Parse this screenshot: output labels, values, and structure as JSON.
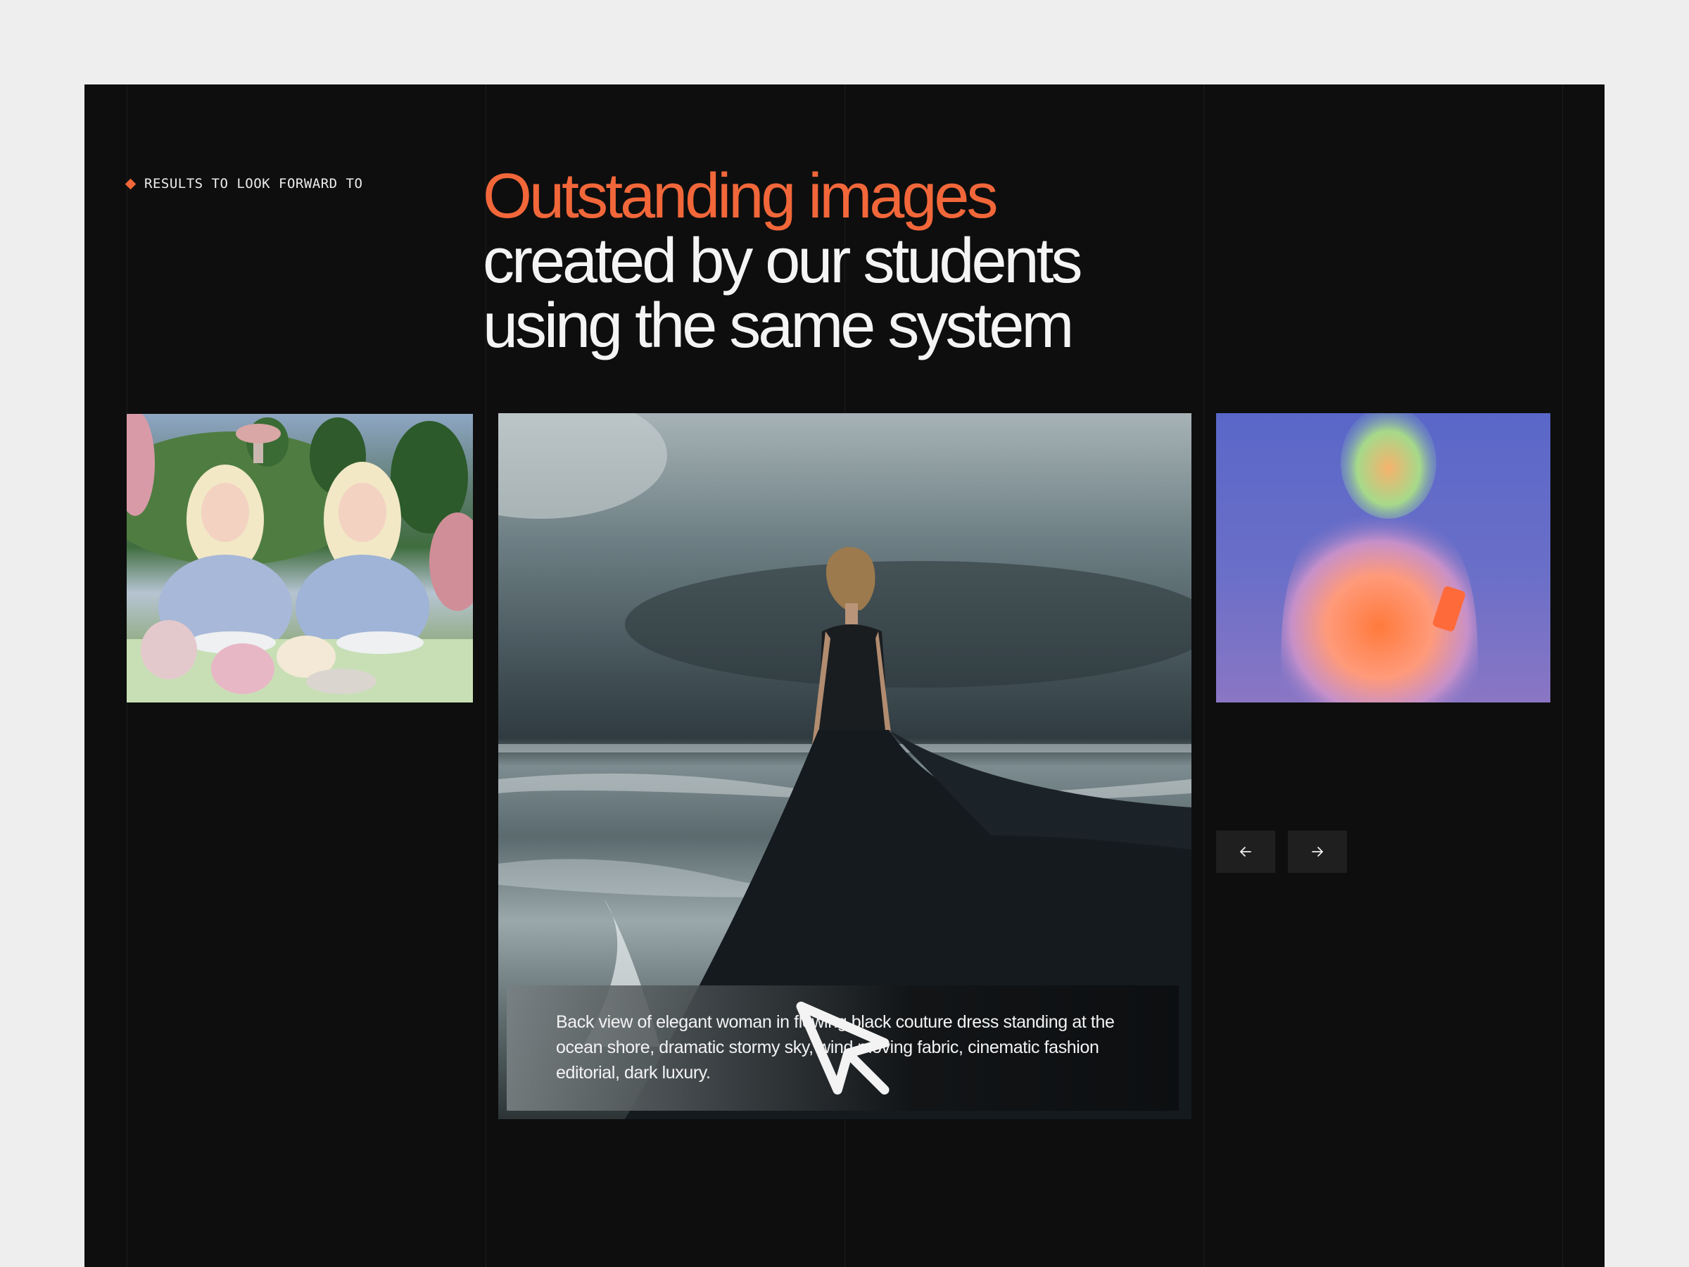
{
  "section": {
    "eyebrow": "RESULTS TO LOOK FORWARD TO",
    "headline": {
      "accent_line": "Outstanding images",
      "line2": "created by our students",
      "line3": "using the same system"
    }
  },
  "gallery": {
    "images": [
      {
        "subject": "Two platinum-blonde girls in gingham dresses at a surreal tea party table with topiary and mushrooms"
      },
      {
        "subject": "Woman in black couture dress on stormy ocean shore"
      },
      {
        "subject": "Glowing gradient silhouette of a person holding a phone"
      }
    ],
    "active_caption": "Back view of elegant woman in flowing black couture dress standing at the ocean shore, dramatic stormy sky, wind moving fabric, cinematic fashion editorial, dark luxury.",
    "caption_icon": "cursor-arrow-icon",
    "controls": {
      "prev_icon": "arrow-left-icon",
      "next_icon": "arrow-right-icon"
    }
  },
  "colors": {
    "page_background": "#eeeeee",
    "panel_background": "#0e0e0e",
    "accent": "#f2673a",
    "text": "#f4f4f4",
    "button_background": "#1f1f1f"
  }
}
